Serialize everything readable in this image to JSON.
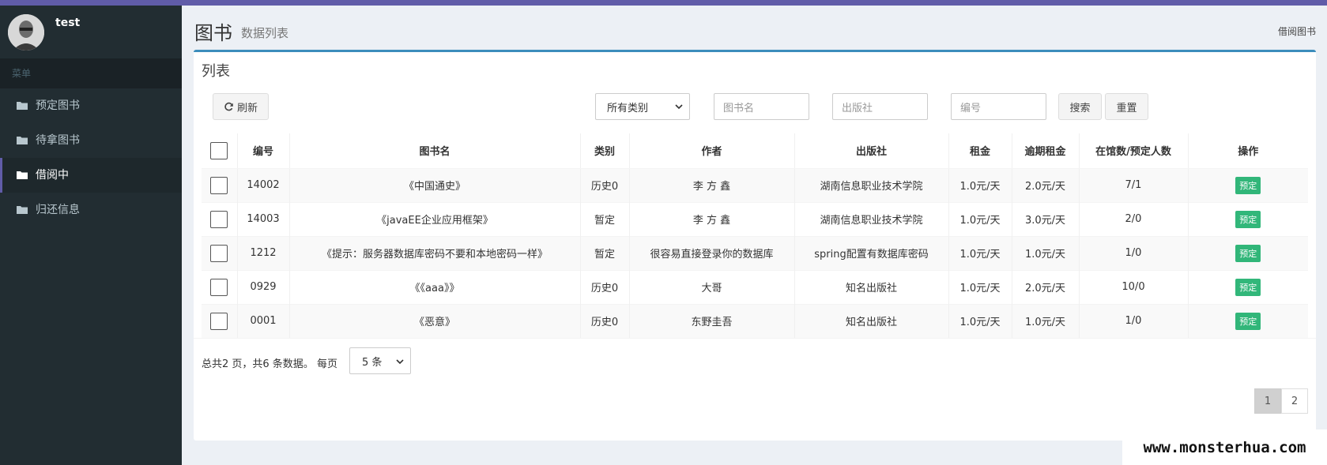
{
  "user": {
    "name": "test"
  },
  "sidebar": {
    "header": "菜单",
    "items": [
      {
        "label": "预定图书",
        "active": false
      },
      {
        "label": "待拿图书",
        "active": false
      },
      {
        "label": "借阅中",
        "active": true
      },
      {
        "label": "归还信息",
        "active": false
      }
    ]
  },
  "header": {
    "title": "图书",
    "subtitle": "数据列表",
    "breadcrumb": "借阅图书"
  },
  "box": {
    "title": "列表"
  },
  "toolbar": {
    "refresh_label": "刷新",
    "category_selected": "所有类别",
    "name_placeholder": "图书名",
    "publisher_placeholder": "出版社",
    "number_placeholder": "编号",
    "search_label": "搜索",
    "reset_label": "重置"
  },
  "table": {
    "columns": [
      "编号",
      "图书名",
      "类别",
      "作者",
      "出版社",
      "租金",
      "逾期租金",
      "在馆数/预定人数",
      "操作"
    ],
    "rows": [
      {
        "id": "14002",
        "name": "《中国通史》",
        "category": "历史0",
        "author": "李 方 鑫",
        "publisher": "湖南信息职业技术学院",
        "rent": "1.0元/天",
        "overdue": "2.0元/天",
        "stock": "7/1",
        "action": "预定"
      },
      {
        "id": "14003",
        "name": "《javaEE企业应用框架》",
        "category": "暂定",
        "author": "李 方 鑫",
        "publisher": "湖南信息职业技术学院",
        "rent": "1.0元/天",
        "overdue": "3.0元/天",
        "stock": "2/0",
        "action": "预定"
      },
      {
        "id": "1212",
        "name": "《提示：服务器数据库密码不要和本地密码一样》",
        "category": "暂定",
        "author": "很容易直接登录你的数据库",
        "publisher": "spring配置有数据库密码",
        "rent": "1.0元/天",
        "overdue": "1.0元/天",
        "stock": "1/0",
        "action": "预定"
      },
      {
        "id": "0929",
        "name": "《《aaa》》",
        "category": "历史0",
        "author": "大哥",
        "publisher": "知名出版社",
        "rent": "1.0元/天",
        "overdue": "2.0元/天",
        "stock": "10/0",
        "action": "预定"
      },
      {
        "id": "0001",
        "name": "《恶意》",
        "category": "历史0",
        "author": "东野圭吾",
        "publisher": "知名出版社",
        "rent": "1.0元/天",
        "overdue": "1.0元/天",
        "stock": "1/0",
        "action": "预定"
      }
    ]
  },
  "pagination": {
    "info": "总共2 页，共6 条数据。 每页",
    "page_size": "5 条",
    "pages": [
      "1",
      "2"
    ],
    "current": "1"
  },
  "watermark": "www.monsterhua.com",
  "colors": {
    "accent": "#605ca8",
    "box_border": "#3c8dbc",
    "badge": "#00a65a",
    "sidebar_bg": "#222d32"
  }
}
